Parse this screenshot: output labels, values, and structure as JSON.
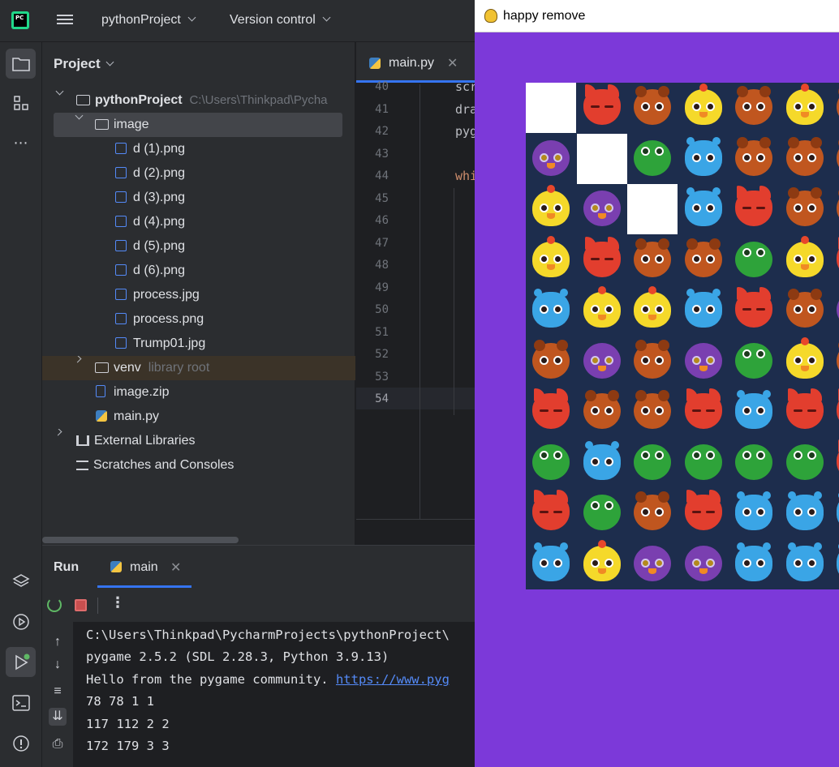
{
  "topbar": {
    "project_menu": "pythonProject",
    "vcs_menu": "Version control"
  },
  "left_strip": {
    "icons": [
      "folder-icon",
      "structure-icon",
      "more-icon",
      "layers-icon",
      "services-icon",
      "run-icon",
      "terminal-icon",
      "problems-icon"
    ]
  },
  "project_panel": {
    "title": "Project",
    "root": {
      "name": "pythonProject",
      "path": "C:\\Users\\Thinkpad\\Pycha"
    },
    "image_folder": "image",
    "image_files": [
      "d (1).png",
      "d (2).png",
      "d (3).png",
      "d (4).png",
      "d (5).png",
      "d (6).png",
      "process.jpg",
      "process.png",
      "Trump01.jpg"
    ],
    "venv": {
      "name": "venv",
      "note": "library root"
    },
    "root_files": [
      "image.zip",
      "main.py"
    ],
    "external_libraries": "External Libraries",
    "scratches": "Scratches and Consoles"
  },
  "editor": {
    "tab": "main.py",
    "line_numbers": [
      "40",
      "41",
      "42",
      "43",
      "44",
      "45",
      "46",
      "47",
      "48",
      "49",
      "50",
      "51",
      "52",
      "53",
      "54"
    ],
    "current_line": "54",
    "code_fragments": {
      "line40": "scr",
      "line41": "dra",
      "line42": "pyg",
      "line44": "whi"
    }
  },
  "run_panel": {
    "title": "Run",
    "tab": "main",
    "console": [
      "C:\\Users\\Thinkpad\\PycharmProjects\\pythonProject\\",
      "pygame 2.5.2 (SDL 2.28.3, Python 3.9.13)",
      "78 78 1 1",
      "117 112 2 2",
      "172 179 3 3"
    ],
    "hello_text": "Hello from the pygame community. ",
    "hello_link": "https://www.pyg"
  },
  "game_window": {
    "title": "happy remove",
    "background_color": "#7c39d9",
    "grid": [
      [
        "blank",
        "fox",
        "bear",
        "chick",
        "bear",
        "chick",
        "bear"
      ],
      [
        "owl",
        "blank",
        "frog",
        "blue",
        "bear",
        "bear",
        "bear"
      ],
      [
        "chick",
        "owl",
        "blank",
        "blue",
        "fox",
        "bear",
        "bear"
      ],
      [
        "chick",
        "fox",
        "bear",
        "bear",
        "frog",
        "chick",
        "fox"
      ],
      [
        "blue",
        "chick",
        "chick",
        "blue",
        "fox",
        "bear",
        "owl"
      ],
      [
        "bear",
        "owl",
        "bear",
        "owl",
        "frog",
        "chick",
        "bear"
      ],
      [
        "fox",
        "bear",
        "bear",
        "fox",
        "blue",
        "fox",
        "fox"
      ],
      [
        "frog",
        "blue",
        "frog",
        "frog",
        "frog",
        "frog",
        "fox"
      ],
      [
        "fox",
        "frog",
        "bear",
        "fox",
        "blue",
        "blue",
        "blue"
      ],
      [
        "blue",
        "chick",
        "owl",
        "owl",
        "blue",
        "blue",
        "blue"
      ]
    ]
  }
}
